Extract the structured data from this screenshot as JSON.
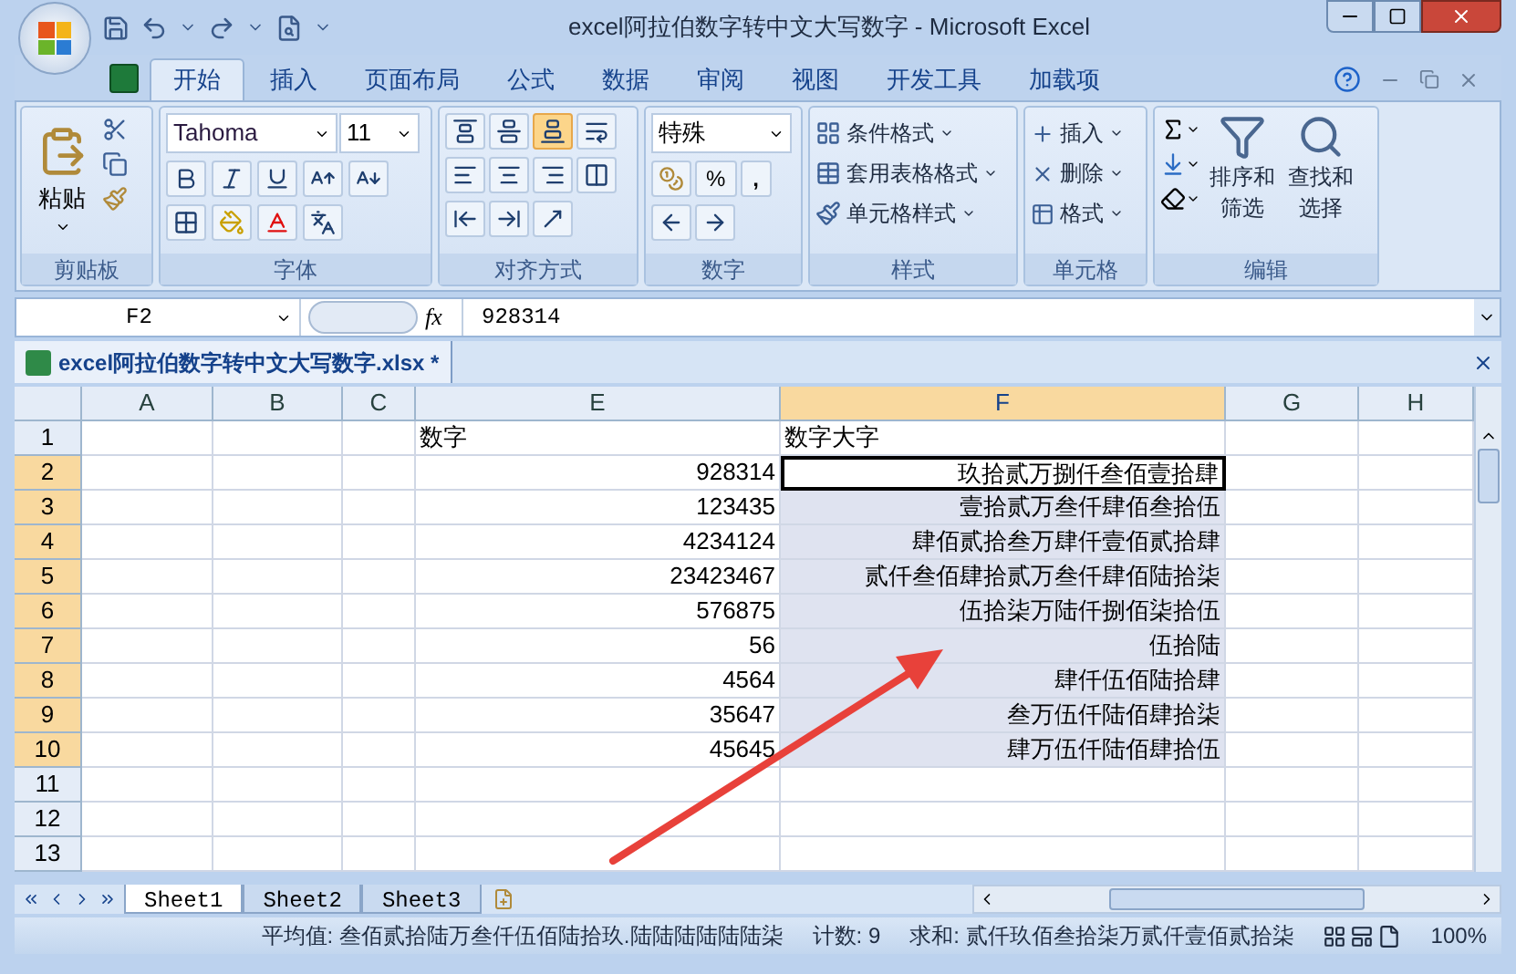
{
  "window": {
    "title": "excel阿拉伯数字转中文大写数字 - Microsoft Excel"
  },
  "menu_tabs": [
    {
      "label": "开始",
      "selected": true
    },
    {
      "label": "插入",
      "selected": false
    },
    {
      "label": "页面布局",
      "selected": false
    },
    {
      "label": "公式",
      "selected": false
    },
    {
      "label": "数据",
      "selected": false
    },
    {
      "label": "审阅",
      "selected": false
    },
    {
      "label": "视图",
      "selected": false
    },
    {
      "label": "开发工具",
      "selected": false
    },
    {
      "label": "加载项",
      "selected": false
    }
  ],
  "ribbon": {
    "clipboard": {
      "name": "剪贴板",
      "paste": "粘贴"
    },
    "font": {
      "name": "字体",
      "family": "Tahoma",
      "size": "11"
    },
    "alignment": {
      "name": "对齐方式",
      "vertical_align": [
        {
          "selected": false
        },
        {
          "selected": false
        },
        {
          "selected": true
        }
      ]
    },
    "number": {
      "name": "数字",
      "format": "特殊",
      "percent": "%",
      "comma": ","
    },
    "styles": {
      "name": "样式",
      "buttons": [
        "条件格式",
        "套用表格格式",
        "单元格样式"
      ]
    },
    "cells": {
      "name": "单元格",
      "buttons": [
        "插入",
        "删除",
        "格式"
      ]
    },
    "editing": {
      "name": "编辑",
      "buttons": [
        "排序和筛选",
        "查找和选择"
      ]
    }
  },
  "formula_bar": {
    "name_box": "F2",
    "fx": "fx",
    "formula": "928314"
  },
  "document_tab": {
    "title": "excel阿拉伯数字转中文大写数字.xlsx *"
  },
  "sheet": {
    "columns": [
      {
        "label": "A",
        "selected": false
      },
      {
        "label": "B",
        "selected": false
      },
      {
        "label": "C",
        "selected": false
      },
      {
        "label": "E",
        "selected": false
      },
      {
        "label": "F",
        "selected": true
      },
      {
        "label": "G",
        "selected": false
      },
      {
        "label": "H",
        "selected": false
      }
    ],
    "rows": [
      {
        "header": "1",
        "selected": false,
        "active": false,
        "cells": {
          "E": "数字",
          "F": "数字大字"
        }
      },
      {
        "header": "2",
        "selected": true,
        "active": true,
        "cells": {
          "E": "928314",
          "F": "玖拾贰万捌仟叁佰壹拾肆"
        }
      },
      {
        "header": "3",
        "selected": true,
        "active": false,
        "cells": {
          "E": "123435",
          "F": "壹拾贰万叁仟肆佰叁拾伍"
        }
      },
      {
        "header": "4",
        "selected": true,
        "active": false,
        "cells": {
          "E": "4234124",
          "F": "肆佰贰拾叁万肆仟壹佰贰拾肆"
        }
      },
      {
        "header": "5",
        "selected": true,
        "active": false,
        "cells": {
          "E": "23423467",
          "F": "贰仟叁佰肆拾贰万叁仟肆佰陆拾柒"
        }
      },
      {
        "header": "6",
        "selected": true,
        "active": false,
        "cells": {
          "E": "576875",
          "F": "伍拾柒万陆仟捌佰柒拾伍"
        }
      },
      {
        "header": "7",
        "selected": true,
        "active": false,
        "cells": {
          "E": "56",
          "F": "伍拾陆"
        }
      },
      {
        "header": "8",
        "selected": true,
        "active": false,
        "cells": {
          "E": "4564",
          "F": "肆仟伍佰陆拾肆"
        }
      },
      {
        "header": "9",
        "selected": true,
        "active": false,
        "cells": {
          "E": "35647",
          "F": "叁万伍仟陆佰肆拾柒"
        }
      },
      {
        "header": "10",
        "selected": true,
        "active": false,
        "cells": {
          "E": "45645",
          "F": "肆万伍仟陆佰肆拾伍"
        }
      },
      {
        "header": "11",
        "selected": false,
        "active": false,
        "cells": {}
      },
      {
        "header": "12",
        "selected": false,
        "active": false,
        "cells": {}
      },
      {
        "header": "13",
        "selected": false,
        "active": false,
        "cells": {}
      }
    ]
  },
  "sheet_tabs": [
    {
      "label": "Sheet1",
      "selected": true
    },
    {
      "label": "Sheet2",
      "selected": false
    },
    {
      "label": "Sheet3",
      "selected": false
    }
  ],
  "status_bar": {
    "average": "平均值: 叁佰贰拾陆万叁仟伍佰陆拾玖.陆陆陆陆陆陆柒",
    "count": "计数: 9",
    "sum": "求和: 贰仟玖佰叁拾柒万贰仟壹佰贰拾柒",
    "zoom": "100%"
  }
}
